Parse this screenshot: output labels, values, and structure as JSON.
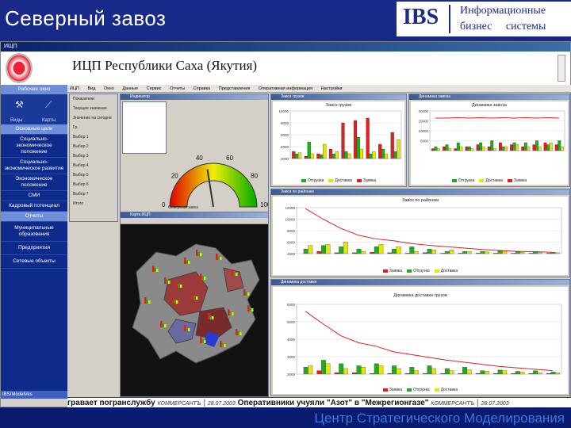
{
  "slide": {
    "title": "Северный завоз",
    "logo_text": "IBS",
    "logo_line1": "Информационные",
    "logo_line2": "бизнес системы",
    "footer": "Центр Стратегического Моделирования"
  },
  "app": {
    "window_title": "ИЩП",
    "banner_title": "ИЦП Республики Саха (Якутия)",
    "menu": [
      "ИЦП",
      "Вид",
      "Окно",
      "Данные",
      "Сервис",
      "Отчеты",
      "Справка",
      "Представления",
      "Оперативная информация",
      "Настройки"
    ]
  },
  "sidebar": {
    "header": "Рабочее окно",
    "icons": [
      {
        "label": "Виды",
        "icon": "tool-icon"
      },
      {
        "label": "Карты",
        "icon": "pin-icon"
      }
    ],
    "items": [
      {
        "label": "Основные цели",
        "active": true
      },
      {
        "label": "Социально-экономическое положение",
        "active": false
      },
      {
        "label": "Социально-экономическое развитие",
        "active": false
      },
      {
        "label": "Экономическое положение",
        "active": false
      },
      {
        "label": "СМИ",
        "active": false
      },
      {
        "label": "Кадровый потенциал",
        "active": false
      },
      {
        "label": "Отчеты",
        "active": true
      },
      {
        "label": "Муниципальные образования",
        "active": false
      },
      {
        "label": "Предприятия",
        "active": false
      },
      {
        "label": "Сетевые объекты",
        "active": false
      }
    ],
    "footer": "IBS/ModelVes"
  },
  "nav_panel": {
    "rows": [
      "Показатели",
      "Текущее значение",
      "Значение на сегодня",
      "Гр.",
      "Выбор 1",
      "Выбор 2",
      "Выбор 3",
      "Выбор 4",
      "Выбор 5",
      "Выбор 6",
      "Выбор 7",
      "Итого"
    ]
  },
  "gauge": {
    "ticks": [
      "0",
      "20",
      "40",
      "60",
      "80",
      "100"
    ],
    "value": 45,
    "caption": "Северный завоз"
  },
  "map": {
    "title": "Карта ИЦП"
  },
  "charts": {
    "c1_title": "Завоз грузов",
    "c2_title": "Динамика завоза",
    "c3_title": "Завоз по районам",
    "c4_title": "Динамика доставки грузов"
  },
  "legend": [
    "Заявка",
    "Отгрузка",
    "Доставка"
  ],
  "colors": {
    "red": "#e02020",
    "green": "#22aa22",
    "yellow": "#e6e600"
  },
  "ticker": {
    "part1": "грaвает погранслужбу",
    "src1": "КОММЕРСАНТЪ",
    "date1": "28.07.2003",
    "part2": "Оперативники учуяли \"Азот\" в \"Межрегионгазе\"",
    "src2": "КОММЕРСАНТЪ",
    "date2": "28.07.2003"
  }
}
